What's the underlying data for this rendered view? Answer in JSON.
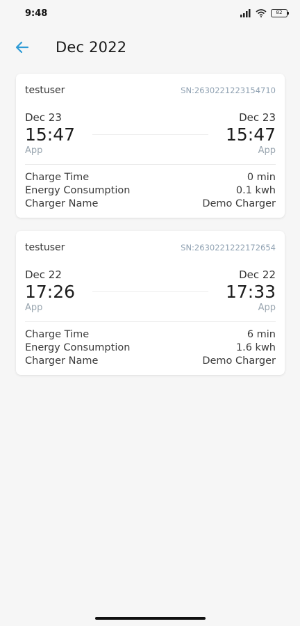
{
  "status": {
    "time": "9:48",
    "battery": "82"
  },
  "header": {
    "title": "Dec 2022"
  },
  "colors": {
    "accent": "#2e9bd6",
    "sn": "#8fa1b2"
  },
  "records": [
    {
      "user": "testuser",
      "sn": "SN:2630221223154710",
      "start": {
        "date": "Dec 23",
        "time": "15:47",
        "source": "App"
      },
      "end": {
        "date": "Dec 23",
        "time": "15:47",
        "source": "App"
      },
      "details": [
        {
          "label": "Charge Time",
          "value": "0 min"
        },
        {
          "label": "Energy Consumption",
          "value": "0.1 kwh"
        },
        {
          "label": "Charger Name",
          "value": "Demo Charger"
        }
      ]
    },
    {
      "user": "testuser",
      "sn": "SN:2630221222172654",
      "start": {
        "date": "Dec 22",
        "time": "17:26",
        "source": "App"
      },
      "end": {
        "date": "Dec 22",
        "time": "17:33",
        "source": "App"
      },
      "details": [
        {
          "label": "Charge Time",
          "value": "6 min"
        },
        {
          "label": "Energy Consumption",
          "value": "1.6 kwh"
        },
        {
          "label": "Charger Name",
          "value": "Demo Charger"
        }
      ]
    }
  ]
}
